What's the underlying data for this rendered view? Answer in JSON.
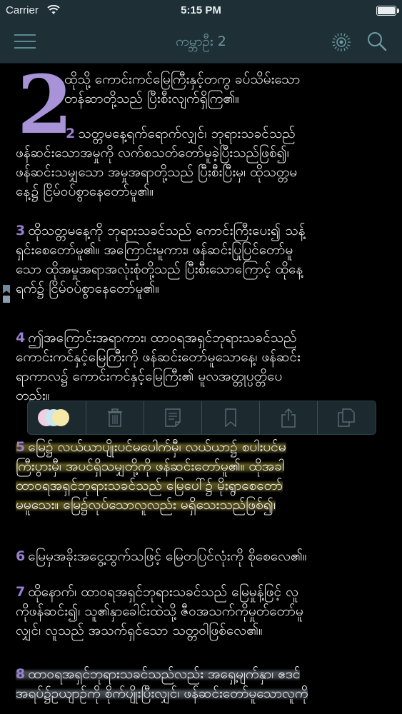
{
  "status": {
    "carrier": "Carrier",
    "time": "5:15 PM"
  },
  "nav": {
    "title": "ကမ္ဘာဦး 2"
  },
  "chapter": {
    "number": "2"
  },
  "paragraphs": [
    {
      "verse": "",
      "lines": [
        "ထိုသို့ ကောင်းကင်မြေကြီးနှင့်တကွ ခပ်သိမ်းသော",
        "တန်ဆာတို့သည် ပြီးစီးလျက်ရှိကြ၏။"
      ]
    },
    {
      "verse": "2",
      "lines": [
        "သတ္တမနေ့ရက်ရောက်လျှင်၊ ဘုရားသခင်သည်",
        "ဖန်ဆင်းသောအမှုကို လက်စသတ်တော်မူခဲ့ပြီးသည်ဖြစ်၍၊",
        "ဖန်ဆင်းသမျှသော အမှုအရာတို့သည် ပြီးစီးပြီးမှ၊ ထိုသတ္တမ",
        "နေ့၌ ငြိမ်ဝပ်စွာနေတော်မူ၏။"
      ]
    },
    {
      "verse": "3",
      "lines": [
        "ထိုသတ္တမနေ့ကို ဘုရားသခင်သည် ကောင်းကြီးပေး၍ သန့်",
        "ရှင်းစေတော်မူ၏။ အကြောင်းမူကား၊ ဖန်ဆင်းပြုပြင်တော်မူ",
        "သော ထိုအမှုအရာအလုံးစုံတို့သည် ပြီးစီးသောကြောင့် ထိုနေ့",
        "ရက်၌ ငြိမ်ဝပ်စွာနေတော်မူ၏။"
      ]
    },
    {
      "verse": "4",
      "lines": [
        "ဤအကြောင်းအရာကား၊ ထာဝရအရှင်ဘုရားသခင်သည်",
        "ကောင်းကင်နှင့်မြေကြီးကို ဖန်ဆင်းတော်မူသောနေ့၊ ဖန်ဆင်း",
        "ရာကာလ၌ ကောင်းကင်နှင့်မြေကြီး၏ မူလအတ္တုပ္ပတ္တိပေ",
        "တည်း။"
      ]
    },
    {
      "verse": "5",
      "lines": [
        "မြေ၌ လယ်ယာပျိုးပင်မပေါက်မှီ၊ လယ်ယာ၌ စပါးပင်မ",
        "ကြီးပွားမှီ၊ အပင်ရှိသမျှတို့ကို ဖန်ဆင်းတော်မူ၏။ ထိုအခါ",
        "ထာဝရအရှင်ဘုရားသခင်သည် မြေပေါ်၌ မိုးရွာစေတော်",
        "မမူသေး။ မြေ၌လုပ်သောလူလည်း မရှိသေးသည်ဖြစ်၍၊"
      ]
    },
    {
      "verse": "6",
      "lines": [
        "မြေမှအခိုးအငွေ့ထွက်သဖြင့် မြေတပြင်လုံးကို စိုစေလေ၏။"
      ]
    },
    {
      "verse": "7",
      "lines": [
        "ထိုနောက်၊ ထာဝရအရှင်ဘုရားသခင်သည် မြေမှုန့်ဖြင့် လူ",
        "ကိုဖန်ဆင်း၍၊ သူ၏နှာခေါင်းထဲသို့ ဇီဝအသက်ကိုမှုတ်တော်မူ",
        "လျှင်၊ လူသည် အသက်ရှင်သော သတ္တဝါဖြစ်လေ၏။"
      ]
    },
    {
      "verse": "8",
      "lines": [
        "ထာဝရအရှင်ဘုရားသခင်သည်လည်း အရှေ့မျက်နှာ၊ ဧဒင်",
        "အရပ်၌ဥယျာဉ်ကို စိုက်ပျိုးပြီးလျှင်၊ ဖန်ဆင်းတော်မူသောလူကို"
      ]
    }
  ],
  "toolbar": {
    "colors": [
      "#f4e9a8",
      "#c9e6f2",
      "#f0cfe0"
    ],
    "icons": [
      "trash-icon",
      "note-icon",
      "bookmark-icon",
      "share-icon",
      "copy-icon"
    ]
  }
}
